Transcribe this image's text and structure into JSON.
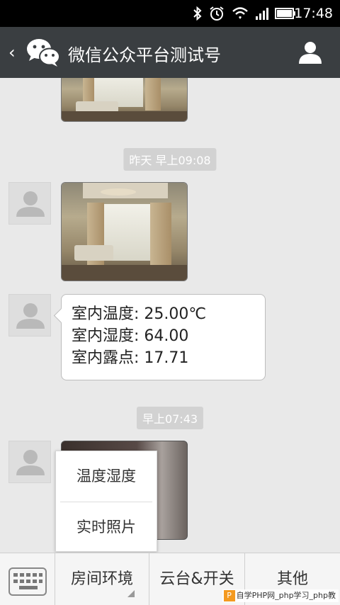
{
  "status_bar": {
    "time": "17:48",
    "icons": [
      "bluetooth-icon",
      "alarm-icon",
      "wifi-icon",
      "signal-icon",
      "battery-icon"
    ]
  },
  "header": {
    "back_icon": "back-chevron-icon",
    "logo_icon": "wechat-logo-icon",
    "title": "微信公众平台测试号",
    "profile_icon": "profile-icon"
  },
  "messages": {
    "timestamp_1": "昨天 早上09:08",
    "sensor": {
      "temperature": "室内温度: 25.00℃",
      "humidity": "室内湿度: 64.00",
      "dewpoint": "室内露点: 17.71"
    },
    "timestamp_2": "早上07:43"
  },
  "popup_menu": {
    "items": [
      "温度湿度",
      "实时照片"
    ]
  },
  "bottom_menu": {
    "keyboard_icon": "keyboard-icon",
    "items": [
      "房间环境",
      "云台&开关",
      "其他"
    ]
  },
  "watermark": {
    "text": "自学PHP网_php学习_php教",
    "icon_letter": "P"
  },
  "colors": {
    "header_bg": "#3a3e41",
    "chat_bg": "#e9e9e9",
    "bubble_bg": "#ffffff",
    "timestamp_bg": "#d2d2d2",
    "status_bg": "#000000"
  }
}
